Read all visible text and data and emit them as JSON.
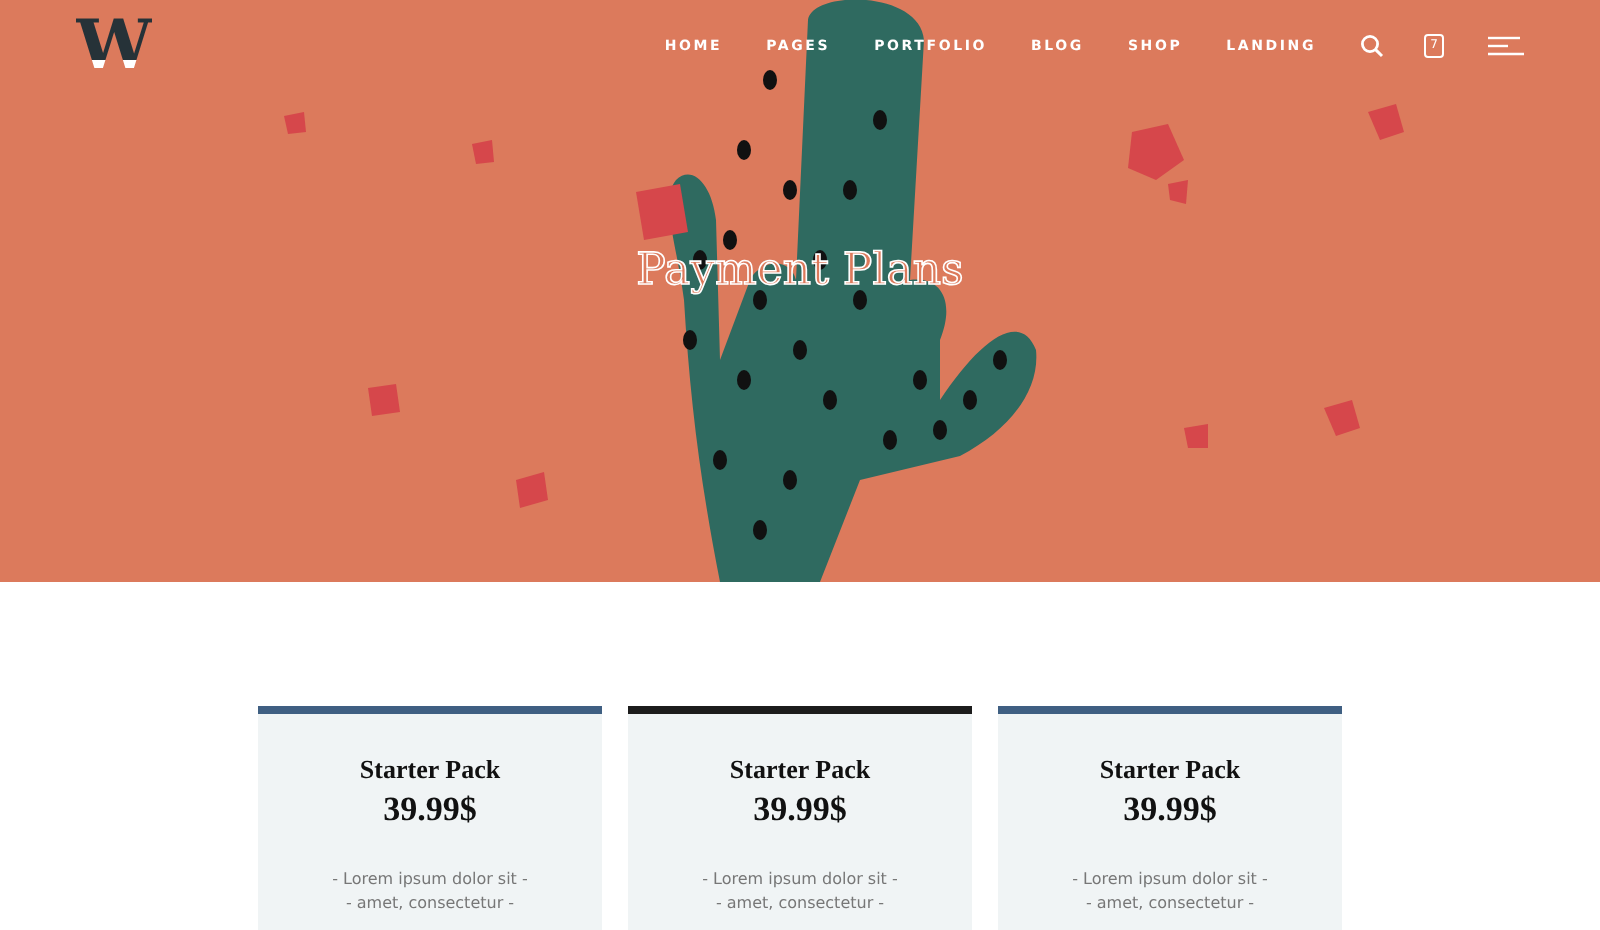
{
  "logo": "W",
  "nav": [
    {
      "label": "HOME"
    },
    {
      "label": "PAGES"
    },
    {
      "label": "PORTFOLIO"
    },
    {
      "label": "BLOG"
    },
    {
      "label": "SHOP"
    },
    {
      "label": "LANDING"
    }
  ],
  "cart_count": "7",
  "hero": {
    "title": "Payment Plans"
  },
  "plans": [
    {
      "name": "Starter Pack",
      "price": "39.99$",
      "color": "#3f5f82",
      "features": [
        "- Lorem ipsum dolor sit -",
        "- amet, consectetur -"
      ]
    },
    {
      "name": "Starter Pack",
      "price": "39.99$",
      "color": "#1c1c1c",
      "features": [
        "- Lorem ipsum dolor sit -",
        "- amet, consectetur -"
      ]
    },
    {
      "name": "Starter Pack",
      "price": "39.99$",
      "color": "#3f5f82",
      "features": [
        "- Lorem ipsum dolor sit -",
        "- amet, consectetur -"
      ]
    }
  ]
}
